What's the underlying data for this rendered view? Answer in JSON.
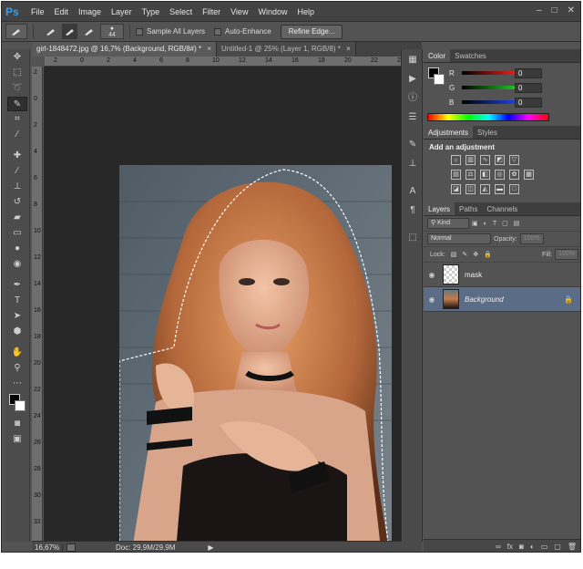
{
  "app": {
    "logo": "Ps",
    "menu": [
      "File",
      "Edit",
      "Image",
      "Layer",
      "Type",
      "Select",
      "Filter",
      "View",
      "Window",
      "Help"
    ],
    "window_controls": [
      "–",
      "□",
      "✕"
    ]
  },
  "options": {
    "brush_size": "44",
    "sample_all_layers": "Sample All Layers",
    "auto_enhance": "Auto-Enhance",
    "refine_edge": "Refine Edge..."
  },
  "tabs": [
    {
      "label": "girl-1848472.jpg @ 16,7% (Background, RGB/8#) *",
      "close": "×"
    },
    {
      "label": "Untitled-1 @ 25% (Layer 1, RGB/8) *",
      "close": "×"
    }
  ],
  "ruler_top_labels": [
    "2",
    "0",
    "2",
    "4",
    "6",
    "8",
    "10",
    "12",
    "14",
    "16",
    "18",
    "20",
    "22",
    "24"
  ],
  "ruler_left_labels": [
    "2",
    "0",
    "2",
    "4",
    "6",
    "8",
    "10",
    "12",
    "14",
    "16",
    "18",
    "20",
    "22",
    "24",
    "26",
    "28",
    "30",
    "32"
  ],
  "status": {
    "zoom": "16,67%",
    "doc": "Doc: 29,9M/29,9M"
  },
  "color_panel": {
    "tabs": [
      "Color",
      "Swatches"
    ],
    "channels": [
      {
        "label": "R",
        "value": "0",
        "color": "#e02020"
      },
      {
        "label": "G",
        "value": "0",
        "color": "#20c020"
      },
      {
        "label": "B",
        "value": "0",
        "color": "#2040e0"
      }
    ]
  },
  "adjustments_panel": {
    "tabs": [
      "Adjustments",
      "Styles"
    ],
    "title": "Add an adjustment"
  },
  "layers_panel": {
    "tabs": [
      "Layers",
      "Paths",
      "Channels"
    ],
    "kind": "Kind",
    "blend_mode": "Normal",
    "opacity_label": "Opacity:",
    "opacity_value": "100%",
    "lock_label": "Lock:",
    "fill_label": "Fill:",
    "fill_value": "100%",
    "layers": [
      {
        "name": "mask",
        "selected": false
      },
      {
        "name": "Background",
        "selected": true
      }
    ]
  }
}
